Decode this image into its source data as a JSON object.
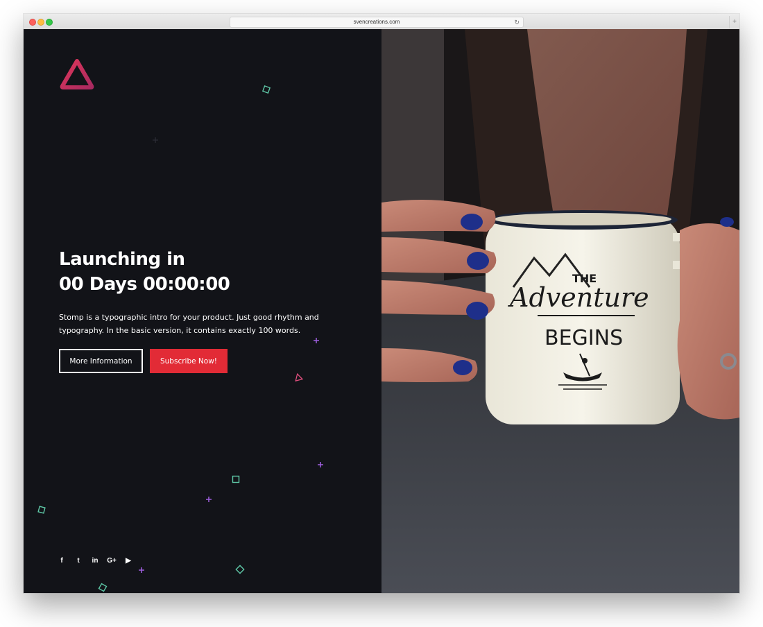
{
  "browser": {
    "url": "svencreations.com"
  },
  "hero": {
    "headline_line1": "Launching in",
    "headline_line2": "00 Days 00:00:00",
    "description": "Stomp is a typographic intro for your product. Just good rhythm and typography. In the basic version, it contains exactly 100 words.",
    "primary_button": "More Information",
    "secondary_button": "Subscribe Now!"
  },
  "socials": [
    {
      "icon": "facebook-icon",
      "glyph": "f"
    },
    {
      "icon": "twitter-icon",
      "glyph": "t"
    },
    {
      "icon": "linkedin-icon",
      "glyph": "in"
    },
    {
      "icon": "google-plus-icon",
      "glyph": "G+"
    },
    {
      "icon": "youtube-icon",
      "glyph": "▶"
    }
  ],
  "photo": {
    "mug_text_top": "THE",
    "mug_text_script": "Adventure",
    "mug_text_bottom": "BEGINS"
  },
  "colors": {
    "background": "#121318",
    "accent_red": "#e22b36",
    "logo_gradient_start": "#e0365a",
    "logo_gradient_end": "#b8285c",
    "deco_green": "#5fc9a8",
    "deco_purple": "#a05fe0",
    "deco_pink": "#e04f7e"
  }
}
